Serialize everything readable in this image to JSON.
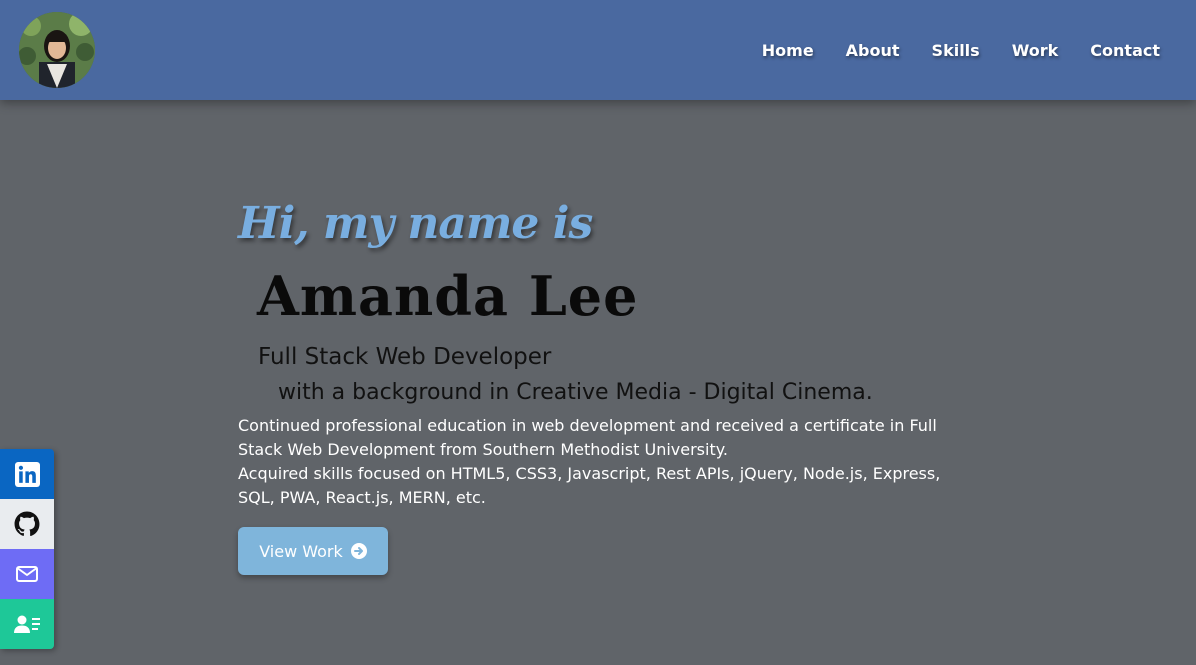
{
  "header": {
    "avatar_alt": "Amanda Lee profile photo",
    "nav": [
      {
        "label": "Home"
      },
      {
        "label": "About"
      },
      {
        "label": "Skills"
      },
      {
        "label": "Work"
      },
      {
        "label": "Contact"
      }
    ]
  },
  "hero": {
    "greeting": "Hi, my name is",
    "name": "Amanda Lee",
    "role": "Full Stack Web Developer",
    "background": "with a background in Creative Media - Digital Cinema.",
    "description": [
      "Continued professional education in web development and received a certificate in Full Stack Web Development from Southern Methodist University.",
      "Acquired skills focused on HTML5, CSS3, Javascript, Rest APIs, jQuery, Node.js, Express, SQL, PWA, React.js, MERN, etc."
    ],
    "cta_label": "View Work",
    "cta_icon": "arrow-circle-right-icon"
  },
  "social": [
    {
      "icon": "linkedin-icon",
      "color": "#0a66c2"
    },
    {
      "icon": "github-icon",
      "color": "#e9ecef"
    },
    {
      "icon": "email-icon",
      "color": "#6e6cf5"
    },
    {
      "icon": "resume-icon",
      "color": "#1ec898"
    }
  ],
  "colors": {
    "header_bg": "#4a69a0",
    "page_bg": "#606469",
    "accent": "#79aee0",
    "button_bg": "#7fb5db"
  }
}
